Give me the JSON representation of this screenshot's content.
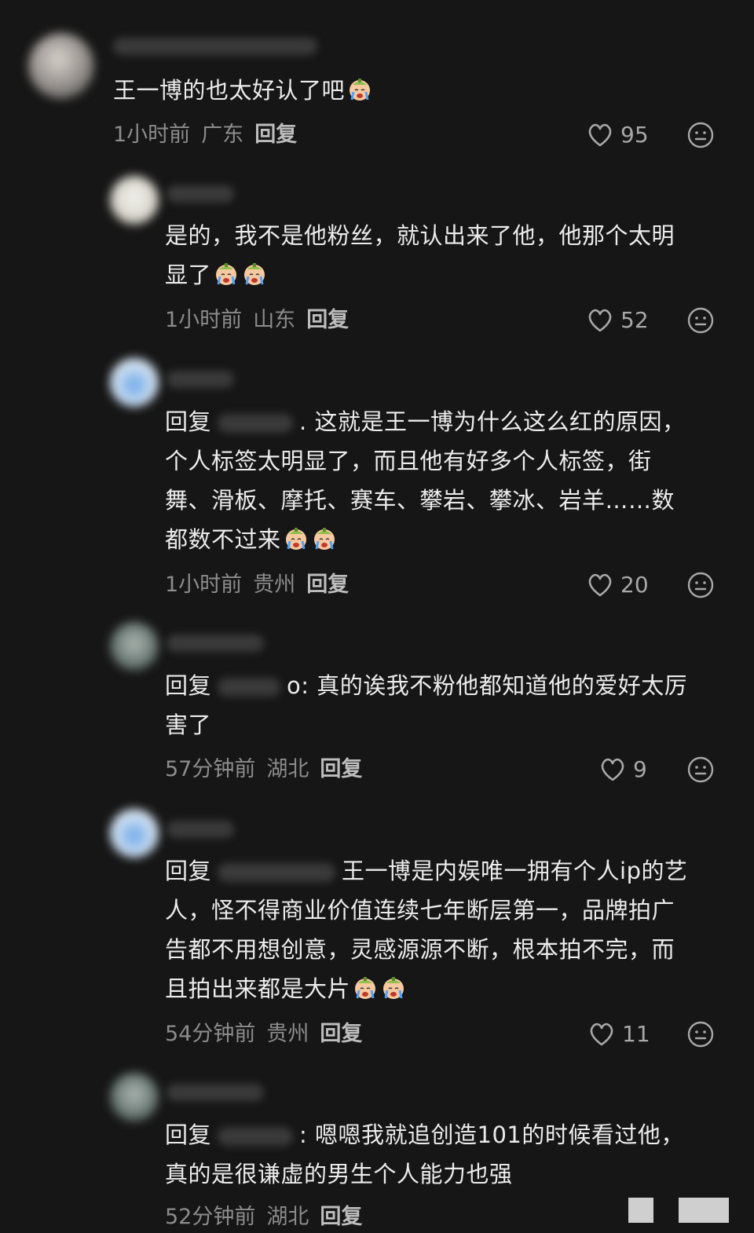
{
  "comments": [
    {
      "text": "王一博的也太好认了吧",
      "emoji_count": 1,
      "time": "1小时前",
      "location": "广东",
      "reply_label": "回复",
      "likes": "95"
    },
    {
      "text_line1": "是的，我不是他粉丝，就认出来了他，他那个太明",
      "text_line2": "显了",
      "emoji_count": 2,
      "time": "1小时前",
      "location": "山东",
      "reply_label": "回复",
      "likes": "52"
    },
    {
      "prefix": "回复",
      "text_line1": ". 这就是王一博为什么这么红的原因，",
      "text_line2": "个人标签太明显了，而且他有好多个人标签，街",
      "text_line3": "舞、滑板、摩托、赛车、攀岩、攀冰、岩羊……数",
      "text_line4": "都数不过来",
      "emoji_count": 2,
      "time": "1小时前",
      "location": "贵州",
      "reply_label": "回复",
      "likes": "20"
    },
    {
      "prefix": "回复",
      "text_line1": "o: 真的诶我不粉他都知道他的爱好太厉",
      "text_line2": "害了",
      "time": "57分钟前",
      "location": "湖北",
      "reply_label": "回复",
      "likes": "9"
    },
    {
      "prefix": "回复",
      "text_line1": "王一博是内娱唯一拥有个人ip的艺",
      "text_line2": "人，怪不得商业价值连续七年断层第一，品牌拍广",
      "text_line3": "告都不用想创意，灵感源源不断，根本拍不完，而",
      "text_line4": "且拍出来都是大片",
      "emoji_count": 2,
      "time": "54分钟前",
      "location": "贵州",
      "reply_label": "回复",
      "likes": "11"
    },
    {
      "prefix": "回复",
      "text_line1": ": 嗯嗯我就追创造101的时候看过他，",
      "text_line2": "真的是很谦虚的男生个人能力也强",
      "time": "52分钟前",
      "location": "湖北",
      "reply_label": "回复"
    }
  ],
  "icons": {
    "like": "heart-outline-icon",
    "dislike": "neutral-face-icon",
    "emoji": "crying-face-emoji"
  }
}
